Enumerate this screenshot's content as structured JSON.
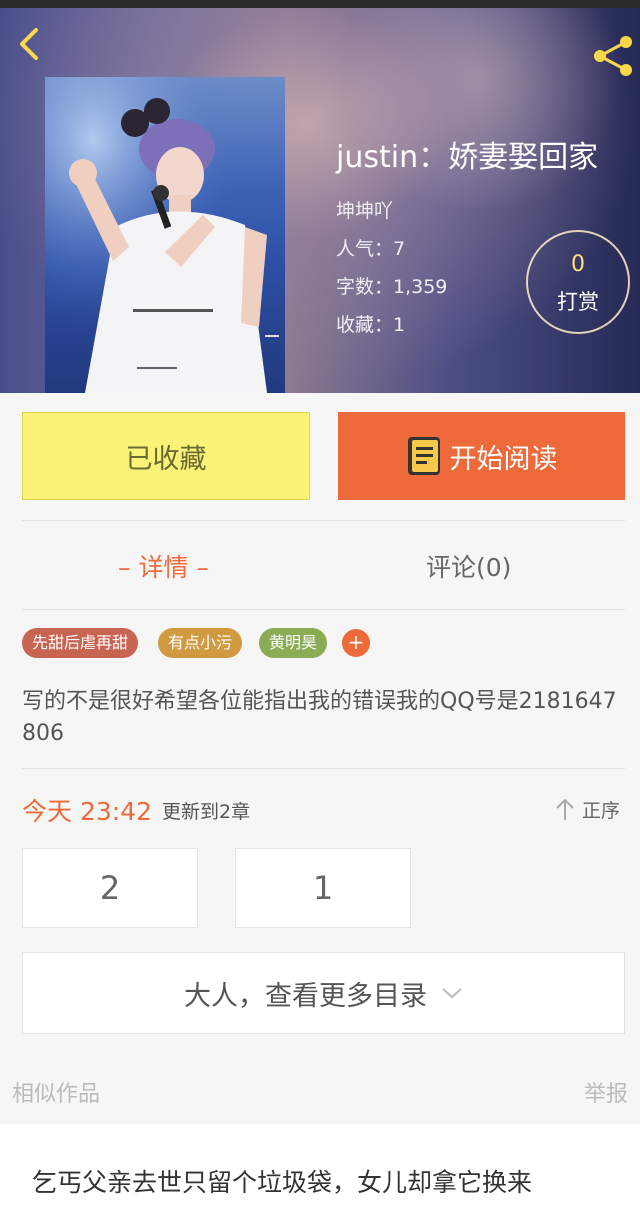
{
  "book": {
    "title": "justin：娇妻娶回家",
    "author": "坤坤吖",
    "popularity": "人气：7",
    "word_count": "字数：1,359",
    "favorites": "收藏：1"
  },
  "tip": {
    "count": "0",
    "label": "打赏"
  },
  "actions": {
    "collected_label": "已收藏",
    "read_label": "开始阅读"
  },
  "tabs": [
    {
      "label": "– 详情 –",
      "active": true
    },
    {
      "label": "评论(0)",
      "active": false
    }
  ],
  "tags": [
    {
      "label": "先甜后虐再甜",
      "color": "#c86552"
    },
    {
      "label": "有点小污",
      "color": "#d19a40"
    },
    {
      "label": "黄明昊",
      "color": "#8aac55"
    }
  ],
  "add_tag_symbol": "+",
  "intro": "写的不是很好希望各位能指出我的错误我的QQ号是2181647806",
  "update": {
    "time": "今天 23:42",
    "count": "更新到2章",
    "sort_label": "正序"
  },
  "chapters": [
    "2",
    "1"
  ],
  "more_catalog_label": "大人，查看更多目录",
  "similar": {
    "label": "相似作品",
    "report": "举报",
    "first_title": "乞丐父亲去世只留个垃圾袋，女儿却拿它换来"
  },
  "colors": {
    "accent": "#ee6a3b",
    "collected_bg": "#fbf377",
    "tip_count": "#ffe27a"
  },
  "icons": [
    "back-arrow-icon",
    "share-icon",
    "book-icon",
    "arrow-up-icon",
    "chevron-down-icon"
  ]
}
